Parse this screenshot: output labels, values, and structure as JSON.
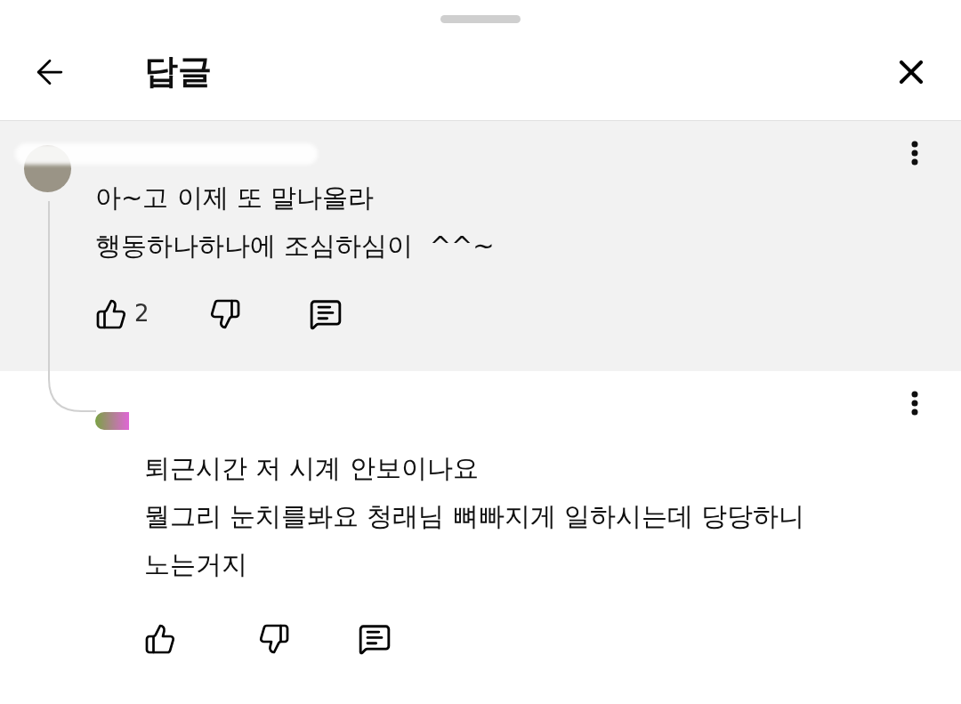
{
  "header": {
    "title": "답글"
  },
  "comments": [
    {
      "highlighted": true,
      "reply": false,
      "lines": [
        "아~고 이제 또 말나올라",
        "행동하나하나에 조심하심이  ^^~"
      ],
      "likes": "2"
    },
    {
      "highlighted": false,
      "reply": true,
      "lines": [
        "퇴근시간 저 시계 안보이나요",
        "뭘그리 눈치를봐요 청래님 뼈빠지게 일하시는데 당당하니",
        "노는거지"
      ]
    }
  ]
}
